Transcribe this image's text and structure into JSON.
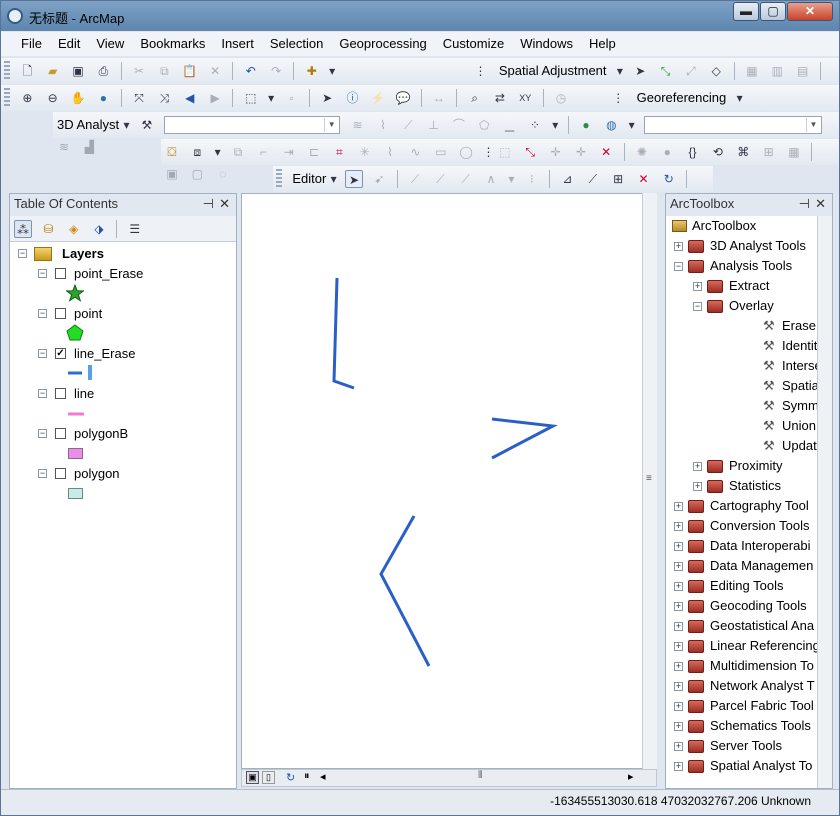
{
  "window": {
    "title": "无标题 - ArcMap",
    "minimize": "▬",
    "maximize": "▢",
    "close": "✕"
  },
  "menu": [
    "File",
    "Edit",
    "View",
    "Bookmarks",
    "Insert",
    "Selection",
    "Geoprocessing",
    "Customize",
    "Windows",
    "Help"
  ],
  "toolbars": {
    "spatial_adjustment": "Spatial Adjustment",
    "georeferencing": "Georeferencing",
    "analyst_3d": "3D Analyst",
    "editor": "Editor"
  },
  "toc": {
    "title": "Table Of Contents",
    "pin": "⊣",
    "close": "✕",
    "root": "Layers",
    "layers": [
      {
        "name": "point_Erase",
        "checked": false,
        "symbol": "star",
        "color": "#2aa52a"
      },
      {
        "name": "point",
        "checked": false,
        "symbol": "pentagon",
        "color": "#22dd22"
      },
      {
        "name": "line_Erase",
        "checked": true,
        "symbol": "line",
        "color": "#2d6fd0"
      },
      {
        "name": "line",
        "checked": false,
        "symbol": "line",
        "color": "#f07ad6"
      },
      {
        "name": "polygonB",
        "checked": false,
        "symbol": "fill",
        "color": "#ea8ee8"
      },
      {
        "name": "polygon",
        "checked": false,
        "symbol": "fill",
        "color": "#c5ece6"
      }
    ],
    "check_mark": "✓",
    "collapse_mark": "−"
  },
  "map": {
    "line_color": "#2a5fc7"
  },
  "toolbox": {
    "title": "ArcToolbox",
    "pin": "⊣",
    "close": "✕",
    "root": "ArcToolbox",
    "items": [
      {
        "label": "3D Analyst Tools",
        "level": 1,
        "expander": "+",
        "kind": "box"
      },
      {
        "label": "Analysis Tools",
        "level": 1,
        "expander": "−",
        "kind": "box"
      },
      {
        "label": "Extract",
        "level": 2,
        "expander": "+",
        "kind": "box"
      },
      {
        "label": "Overlay",
        "level": 2,
        "expander": "−",
        "kind": "box"
      },
      {
        "label": "Erase",
        "level": 3,
        "expander": "",
        "kind": "tool"
      },
      {
        "label": "Identity",
        "level": 3,
        "expander": "",
        "kind": "tool"
      },
      {
        "label": "Intersect",
        "level": 3,
        "expander": "",
        "kind": "tool"
      },
      {
        "label": "Spatial Join",
        "level": 3,
        "expander": "",
        "kind": "tool"
      },
      {
        "label": "Symmetrica",
        "level": 3,
        "expander": "",
        "kind": "tool"
      },
      {
        "label": "Union",
        "level": 3,
        "expander": "",
        "kind": "tool"
      },
      {
        "label": "Update",
        "level": 3,
        "expander": "",
        "kind": "tool"
      },
      {
        "label": "Proximity",
        "level": 2,
        "expander": "+",
        "kind": "box"
      },
      {
        "label": "Statistics",
        "level": 2,
        "expander": "+",
        "kind": "box"
      },
      {
        "label": "Cartography Tool",
        "level": 1,
        "expander": "+",
        "kind": "box"
      },
      {
        "label": "Conversion Tools",
        "level": 1,
        "expander": "+",
        "kind": "box"
      },
      {
        "label": "Data Interoperabi",
        "level": 1,
        "expander": "+",
        "kind": "box"
      },
      {
        "label": "Data Managemen",
        "level": 1,
        "expander": "+",
        "kind": "box"
      },
      {
        "label": "Editing Tools",
        "level": 1,
        "expander": "+",
        "kind": "box"
      },
      {
        "label": "Geocoding Tools",
        "level": 1,
        "expander": "+",
        "kind": "box"
      },
      {
        "label": "Geostatistical Ana",
        "level": 1,
        "expander": "+",
        "kind": "box"
      },
      {
        "label": "Linear Referencing",
        "level": 1,
        "expander": "+",
        "kind": "box"
      },
      {
        "label": "Multidimension To",
        "level": 1,
        "expander": "+",
        "kind": "box"
      },
      {
        "label": "Network Analyst T",
        "level": 1,
        "expander": "+",
        "kind": "box"
      },
      {
        "label": "Parcel Fabric Tool",
        "level": 1,
        "expander": "+",
        "kind": "box"
      },
      {
        "label": "Schematics Tools",
        "level": 1,
        "expander": "+",
        "kind": "box"
      },
      {
        "label": "Server Tools",
        "level": 1,
        "expander": "+",
        "kind": "box"
      },
      {
        "label": "Spatial Analyst To",
        "level": 1,
        "expander": "+",
        "kind": "box"
      }
    ]
  },
  "status": {
    "coordinates": "-163455513030.618  47032032767.206 Unknown"
  }
}
